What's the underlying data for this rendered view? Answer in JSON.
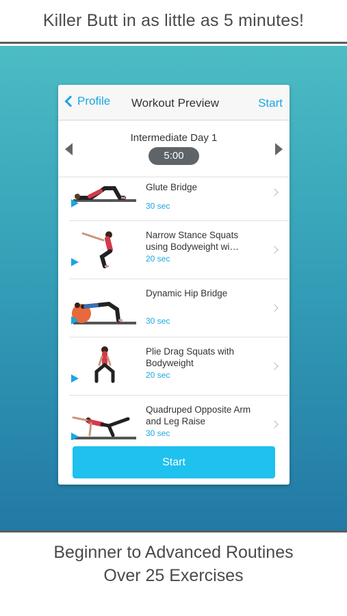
{
  "top_banner": {
    "text": "Killer Butt in as little as 5 minutes!"
  },
  "navbar": {
    "back_label": "Profile",
    "title": "Workout Preview",
    "start_label": "Start"
  },
  "workout": {
    "day_title": "Intermediate Day 1",
    "timer": "5:00"
  },
  "exercises": [
    {
      "name": "Glute Bridge",
      "duration": "30 sec"
    },
    {
      "name": "Narrow Stance Squats using Bodyweight wi…",
      "duration": "20 sec"
    },
    {
      "name": "Dynamic Hip Bridge",
      "duration": "30 sec"
    },
    {
      "name": "Plie Drag Squats with Bodyweight",
      "duration": "20 sec"
    },
    {
      "name": "Quadruped Opposite Arm and Leg Raise",
      "duration": "30 sec"
    }
  ],
  "start_button": {
    "label": "Start"
  },
  "bottom_banner": {
    "line1": "Beginner to Advanced Routines",
    "line2": "Over 25 Exercises"
  },
  "colors": {
    "accent": "#1aa7e0",
    "button": "#1fc1ee",
    "timer_pill": "#5e6468"
  }
}
